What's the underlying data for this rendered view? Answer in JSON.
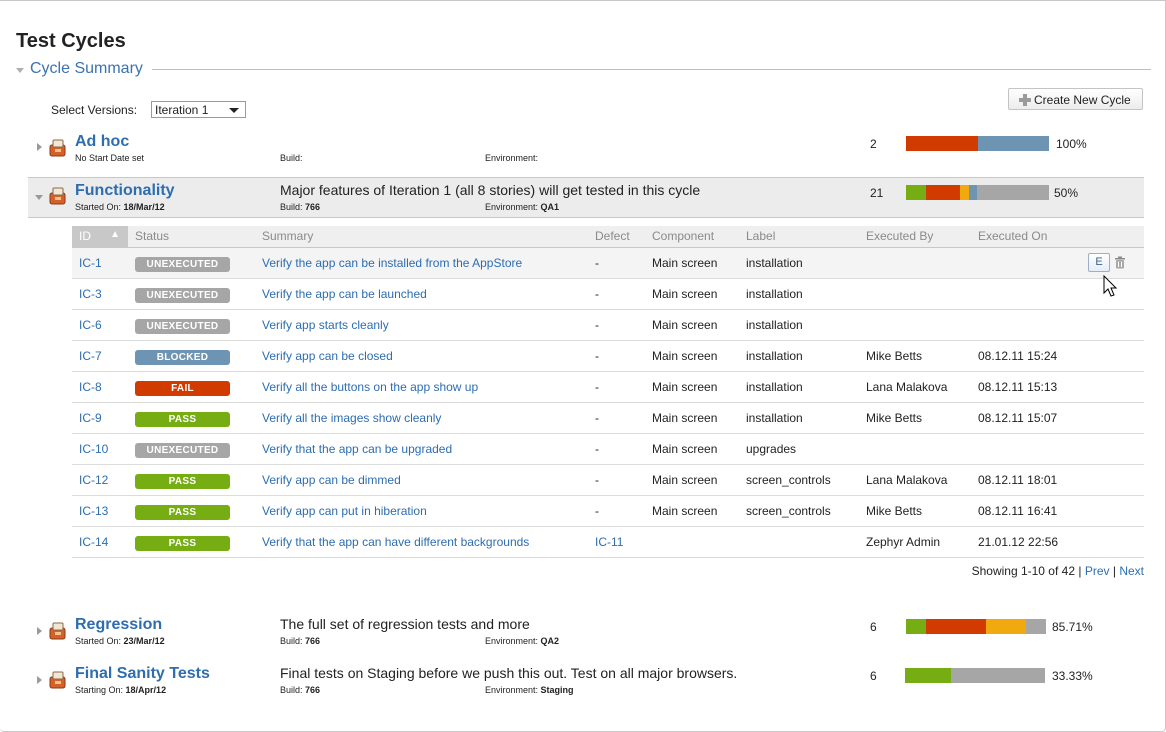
{
  "page": {
    "title": "Test Cycles",
    "section_label": "Cycle Summary"
  },
  "versions": {
    "label": "Select Versions:",
    "selected": "Iteration 1"
  },
  "create_cycle_label": "Create New Cycle",
  "colors": {
    "pass": "#76ad12",
    "fail": "#d13b00",
    "wip": "#f0a90f",
    "blocked": "#6d95b3",
    "unexecuted": "#a6a6a6",
    "link": "#2d6db0"
  },
  "cycles": [
    {
      "name": "Ad hoc",
      "date_label": "No Start Date set",
      "date_value": "",
      "description": "",
      "build_label": "Build:",
      "build": "",
      "env_label": "Environment:",
      "environment": "",
      "count": "2",
      "percent": "100%",
      "progress": [
        {
          "status": "fail",
          "fraction": 0.5
        },
        {
          "status": "blocked",
          "fraction": 0.5
        }
      ]
    },
    {
      "name": "Functionality",
      "date_label": "Started On:",
      "date_value": "18/Mar/12",
      "description": "Major features of Iteration 1 (all 8 stories) will get tested in this cycle",
      "build_label": "Build:",
      "build": "766",
      "env_label": "Environment:",
      "environment": "QA1",
      "count": "21",
      "percent": "50%",
      "progress": [
        {
          "status": "pass",
          "fraction": 0.14
        },
        {
          "status": "fail",
          "fraction": 0.24
        },
        {
          "status": "wip",
          "fraction": 0.06
        },
        {
          "status": "blocked",
          "fraction": 0.06
        },
        {
          "status": "unexecuted",
          "fraction": 0.5
        }
      ]
    },
    {
      "name": "Regression",
      "date_label": "Started On:",
      "date_value": "23/Mar/12",
      "description": "The full set of regression tests and more",
      "build_label": "Build:",
      "build": "766",
      "env_label": "Environment:",
      "environment": "QA2",
      "count": "6",
      "percent": "85.71%",
      "progress": [
        {
          "status": "pass",
          "fraction": 0.14
        },
        {
          "status": "fail",
          "fraction": 0.43
        },
        {
          "status": "wip",
          "fraction": 0.29
        },
        {
          "status": "unexecuted",
          "fraction": 0.14
        }
      ]
    },
    {
      "name": "Final Sanity Tests",
      "date_label": "Starting On:",
      "date_value": "18/Apr/12",
      "description": "Final tests on Staging before we push this out. Test on all major browsers.",
      "build_label": "Build:",
      "build": "766",
      "env_label": "Environment:",
      "environment": "Staging",
      "count": "6",
      "percent": "33.33%",
      "progress": [
        {
          "status": "pass",
          "fraction": 0.33
        },
        {
          "status": "unexecuted",
          "fraction": 0.67
        }
      ]
    }
  ],
  "executions": {
    "columns": [
      "ID",
      "Status",
      "Summary",
      "Defect",
      "Component",
      "Label",
      "Executed By",
      "Executed On"
    ],
    "rows": [
      {
        "id": "IC-1",
        "status": "UNEXECUTED",
        "status_key": "unexecuted",
        "summary": "Verify the app can be installed from the AppStore",
        "defect": "-",
        "component": "Main screen",
        "label": "installation",
        "executed_by": "",
        "executed_on": "",
        "edit_label": "E"
      },
      {
        "id": "IC-3",
        "status": "UNEXECUTED",
        "status_key": "unexecuted",
        "summary": "Verify the app can be launched",
        "defect": "-",
        "component": "Main screen",
        "label": "installation",
        "executed_by": "",
        "executed_on": ""
      },
      {
        "id": "IC-6",
        "status": "UNEXECUTED",
        "status_key": "unexecuted",
        "summary": "Verify app starts cleanly",
        "defect": "-",
        "component": "Main screen",
        "label": "installation",
        "executed_by": "",
        "executed_on": ""
      },
      {
        "id": "IC-7",
        "status": "BLOCKED",
        "status_key": "blocked",
        "summary": "Verify app can be closed",
        "defect": "-",
        "component": "Main screen",
        "label": "installation",
        "executed_by": "Mike Betts",
        "executed_on": "08.12.11 15:24"
      },
      {
        "id": "IC-8",
        "status": "FAIL",
        "status_key": "fail",
        "summary": "Verify all the buttons on the app show up",
        "defect": "-",
        "component": "Main screen",
        "label": "installation",
        "executed_by": "Lana Malakova",
        "executed_on": "08.12.11 15:13"
      },
      {
        "id": "IC-9",
        "status": "PASS",
        "status_key": "pass",
        "summary": "Verify all the images show cleanly",
        "defect": "-",
        "component": "Main screen",
        "label": "installation",
        "executed_by": "Mike Betts",
        "executed_on": "08.12.11 15:07"
      },
      {
        "id": "IC-10",
        "status": "UNEXECUTED",
        "status_key": "unexecuted",
        "summary": "Verify that the app can be upgraded",
        "defect": "-",
        "component": "Main screen",
        "label": "upgrades",
        "executed_by": "",
        "executed_on": ""
      },
      {
        "id": "IC-12",
        "status": "PASS",
        "status_key": "pass",
        "summary": "Verify app can be dimmed",
        "defect": "-",
        "component": "Main screen",
        "label": "screen_controls",
        "executed_by": "Lana Malakova",
        "executed_on": "08.12.11 18:01"
      },
      {
        "id": "IC-13",
        "status": "PASS",
        "status_key": "pass",
        "summary": "Verify app can put in hiberation",
        "defect": "-",
        "component": "Main screen",
        "label": "screen_controls",
        "executed_by": "Mike Betts",
        "executed_on": "08.12.11 16:41"
      },
      {
        "id": "IC-14",
        "status": "PASS",
        "status_key": "pass",
        "summary": "Verify that the app can have different backgrounds",
        "defect": "IC-11",
        "component": "",
        "label": "",
        "executed_by": "Zephyr Admin",
        "executed_on": "21.01.12 22:56"
      }
    ],
    "pager": {
      "showing": "Showing 1-10 of 42",
      "sep1": "|",
      "prev": "Prev",
      "sep2": "|",
      "next": "Next"
    }
  }
}
